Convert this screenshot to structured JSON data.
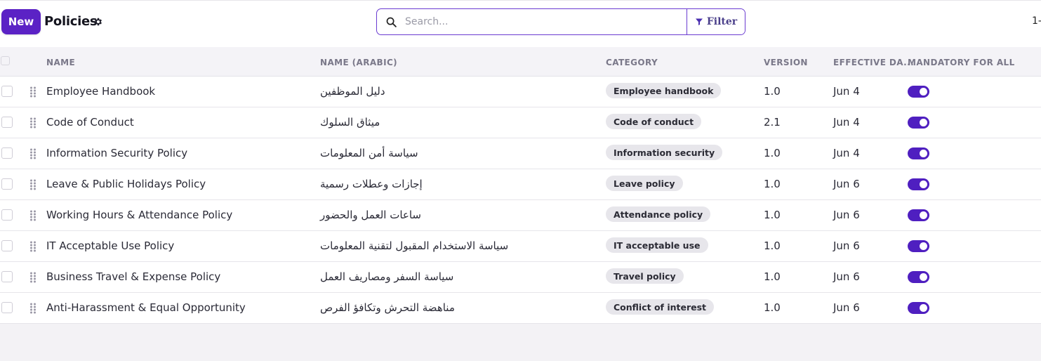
{
  "toolbar": {
    "new_label": "New",
    "title": "Policies",
    "settings_icon": "gear-icon",
    "search_placeholder": "Search...",
    "search_value": "",
    "filter_label": "Filter",
    "pager_text": "1-"
  },
  "table": {
    "headers": {
      "name": "NAME",
      "name_arabic": "NAME (ARABIC)",
      "category": "CATEGORY",
      "version": "VERSION",
      "effective_date": "EFFECTIVE DA...",
      "mandatory": "MANDATORY FOR ALL"
    },
    "rows": [
      {
        "name": "Employee Handbook",
        "name_arabic": "دليل الموظفين",
        "category": "Employee handbook",
        "version": "1.0",
        "effective": "Jun 4",
        "mandatory": true
      },
      {
        "name": "Code of Conduct",
        "name_arabic": "ميثاق السلوك",
        "category": "Code of conduct",
        "version": "2.1",
        "effective": "Jun 4",
        "mandatory": true
      },
      {
        "name": "Information Security Policy",
        "name_arabic": "سياسة أمن المعلومات",
        "category": "Information security",
        "version": "1.0",
        "effective": "Jun 4",
        "mandatory": true
      },
      {
        "name": "Leave & Public Holidays Policy",
        "name_arabic": "إجازات وعطلات رسمية",
        "category": "Leave policy",
        "version": "1.0",
        "effective": "Jun 6",
        "mandatory": true
      },
      {
        "name": "Working Hours & Attendance Policy",
        "name_arabic": "ساعات العمل والحضور",
        "category": "Attendance policy",
        "version": "1.0",
        "effective": "Jun 6",
        "mandatory": true
      },
      {
        "name": "IT Acceptable Use Policy",
        "name_arabic": "سياسة الاستخدام المقبول لتقنية المعلومات",
        "category": "IT acceptable use",
        "version": "1.0",
        "effective": "Jun 6",
        "mandatory": true
      },
      {
        "name": "Business Travel & Expense Policy",
        "name_arabic": "سياسة السفر ومصاريف العمل",
        "category": "Travel policy",
        "version": "1.0",
        "effective": "Jun 6",
        "mandatory": true
      },
      {
        "name": "Anti-Harassment & Equal Opportunity",
        "name_arabic": "مناهضة التحرش وتكافؤ الفرص",
        "category": "Conflict of interest",
        "version": "1.0",
        "effective": "Jun 6",
        "mandatory": true
      }
    ]
  },
  "colors": {
    "accent": "#5b22c5",
    "toggle_on": "#4f1fc0",
    "chip_bg": "#e7e6eb"
  }
}
